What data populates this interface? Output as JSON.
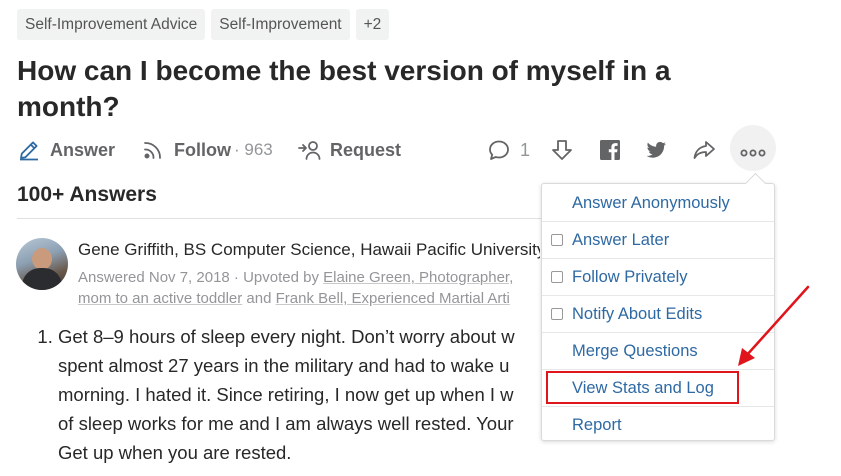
{
  "topics": [
    "Self-Improvement Advice",
    "Self-Improvement",
    "+2"
  ],
  "question": {
    "title": "How can I become the best version of myself in a month?"
  },
  "actions": {
    "answer_label": "Answer",
    "follow_label": "Follow",
    "follow_count": "· 963",
    "request_label": "Request",
    "comment_count": "1"
  },
  "answers_heading": "100+ Answers",
  "answer": {
    "author": "Gene Griffith, BS Computer Science, Hawaii Pacific University",
    "meta_prefix": "Answered Nov 7, 2018 · Upvoted by ",
    "upvoter1": "Elaine Green, Photographer,",
    "upvoter1_rest": " ",
    "meta_line2_a": "mom to an active toddler",
    "meta_line2_mid": " and ",
    "upvoter2": "Frank Bell, Experienced Martial Arti",
    "lines": [
      "Get 8–9 hours of sleep every night. Don’t worry about w",
      "spent almost 27 years in the military and had to wake u",
      "morning. I hated it. Since retiring, I now get up when I w",
      "of sleep works for me and I am always well rested. Your",
      "Get up when you are rested."
    ]
  },
  "menu": {
    "items": [
      {
        "label": "Answer Anonymously",
        "checkbox": false
      },
      {
        "label": "Answer Later",
        "checkbox": true
      },
      {
        "label": "Follow Privately",
        "checkbox": true
      },
      {
        "label": "Notify About Edits",
        "checkbox": true
      },
      {
        "label": "Merge Questions",
        "checkbox": false
      },
      {
        "label": "View Stats and Log",
        "checkbox": false
      },
      {
        "label": "Report",
        "checkbox": false
      }
    ]
  },
  "colors": {
    "link": "#2e69a3",
    "accent_blue": "#2e69a3",
    "highlight_red": "#e0141b",
    "text": "#282829",
    "muted": "#939598"
  },
  "icons": [
    "pencil-icon",
    "follow-signal-icon",
    "request-user-icon",
    "comment-icon",
    "downvote-icon",
    "facebook-icon",
    "twitter-icon",
    "share-icon",
    "more-dots-icon"
  ]
}
